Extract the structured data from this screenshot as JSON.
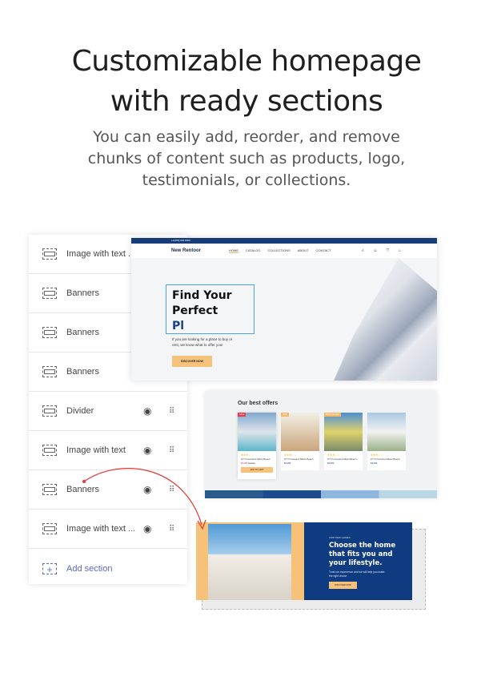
{
  "heading": {
    "line1": "Customizable homepage",
    "line2": "with ready sections"
  },
  "subtitle": "You can easily add, reorder, and remove chunks of content such as products, logo, testimonials, or collections.",
  "sidebar": {
    "items": [
      {
        "label": "Image with text ...",
        "icon": "image-text-icon",
        "controls": false
      },
      {
        "label": "Banners",
        "icon": "banner-icon",
        "controls": false
      },
      {
        "label": "Banners",
        "icon": "banner-icon",
        "controls": false
      },
      {
        "label": "Banners",
        "icon": "banner-icon",
        "controls": false
      },
      {
        "label": "Divider",
        "icon": "banner-icon",
        "controls": true
      },
      {
        "label": "Image with text",
        "icon": "pagespeed-icon",
        "controls": true
      },
      {
        "label": "Banners",
        "icon": "banner-icon",
        "controls": true
      },
      {
        "label": "Image with text ...",
        "icon": "image-text-icon",
        "controls": true
      }
    ],
    "add_label": "Add section",
    "accent": "#5c6bc0"
  },
  "hero": {
    "topbar": "+1(000) 000 0000",
    "logo": "New Rentoor",
    "nav": [
      "HOME",
      "CATALOG",
      "COLLECTIONS",
      "ABOUT",
      "CONTACT"
    ],
    "headline1": "Find Your",
    "headline2": "Perfect",
    "headline3": "Pl",
    "description": "If you are looking for a place to buy or rent, we know what to offer you!",
    "button": "DISCOVER NOW"
  },
  "offers": {
    "title": "Our best offers",
    "cards": [
      {
        "tag": "SALE",
        "name": "2/7 N Cocoanut Miami Beach",
        "price": "$1299",
        "old": "$2299",
        "cta": "ADD TO CART"
      },
      {
        "tag": "NEW",
        "name": "2/7 N Cocoanut Miami Beach",
        "price": "$1299"
      },
      {
        "tag": "BEST SELLER",
        "name": "2/7 N Cocoanut Miami Beach",
        "price": "$1299"
      },
      {
        "tag": "",
        "name": "2/7 N Cocoanut Miami Beach",
        "price": "$1299"
      }
    ]
  },
  "banner": {
    "overline": "FIND NEW HOMES",
    "title": "Choose the home that fits you and your lifestyle.",
    "body": "Trust our experience and we will help you make the right choice",
    "button": "DISCOVER NOW"
  },
  "colors": {
    "navy": "#0f3b80",
    "peach": "#f6c27a",
    "arrow": "#e53935"
  }
}
